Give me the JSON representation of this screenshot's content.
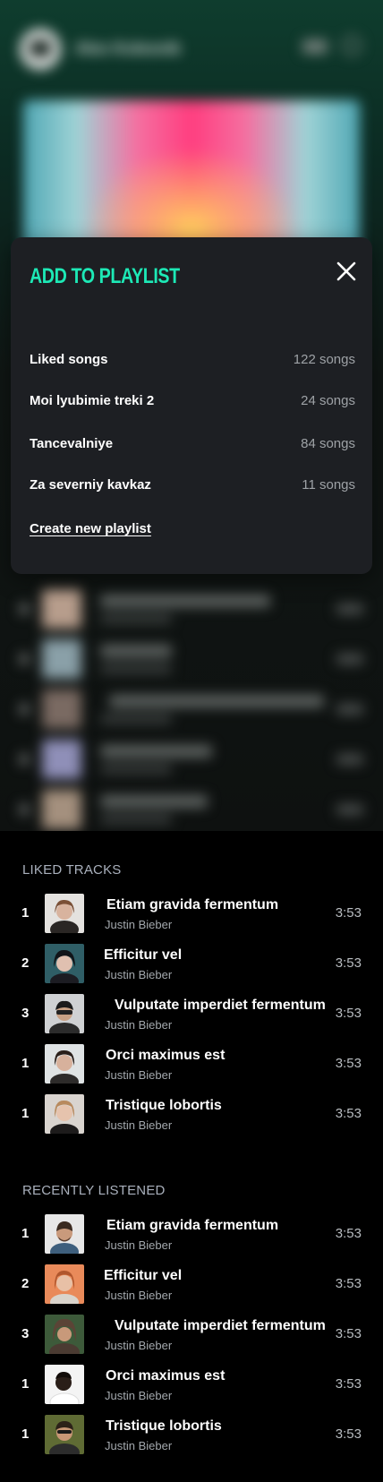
{
  "app": {
    "user_name": "Alex Kolesnik"
  },
  "modal": {
    "title": "ADD TO PLAYLIST",
    "close_icon": "close-icon",
    "playlists": [
      {
        "name": "Liked songs",
        "count": "122 songs"
      },
      {
        "name": "Moi lyubimie treki 2",
        "count": "24 songs"
      },
      {
        "name": "Tancevalniye",
        "count": "84 songs"
      },
      {
        "name": "Za severniy kavkaz",
        "count": "11 songs"
      }
    ],
    "create_label": "Create new playlist",
    "accent_color": "#1de9b6"
  },
  "liked_tracks": {
    "heading": "LIKED TRACKS",
    "items": [
      {
        "num": "1",
        "title": "Etiam gravida fermentum",
        "artist": "Justin Bieber",
        "duration": "3:53"
      },
      {
        "num": "2",
        "title": "Efficitur vel",
        "artist": "Justin Bieber",
        "duration": "3:53"
      },
      {
        "num": "3",
        "title": "Vulputate imperdiet fermentum",
        "artist": "Justin Bieber",
        "duration": "3:53"
      },
      {
        "num": "1",
        "title": "Orci maximus est",
        "artist": "Justin Bieber",
        "duration": "3:53"
      },
      {
        "num": "1",
        "title": "Tristique lobortis",
        "artist": "Justin Bieber",
        "duration": "3:53"
      }
    ]
  },
  "recently_listened": {
    "heading": "RECENTLY LISTENED",
    "items": [
      {
        "num": "1",
        "title": "Etiam gravida fermentum",
        "artist": "Justin Bieber",
        "duration": "3:53"
      },
      {
        "num": "2",
        "title": "Efficitur vel",
        "artist": "Justin Bieber",
        "duration": "3:53"
      },
      {
        "num": "3",
        "title": "Vulputate imperdiet fermentum",
        "artist": "Justin Bieber",
        "duration": "3:53"
      },
      {
        "num": "1",
        "title": "Orci maximus est",
        "artist": "Justin Bieber",
        "duration": "3:53"
      },
      {
        "num": "1",
        "title": "Tristique lobortis",
        "artist": "Justin Bieber",
        "duration": "3:53"
      }
    ]
  }
}
